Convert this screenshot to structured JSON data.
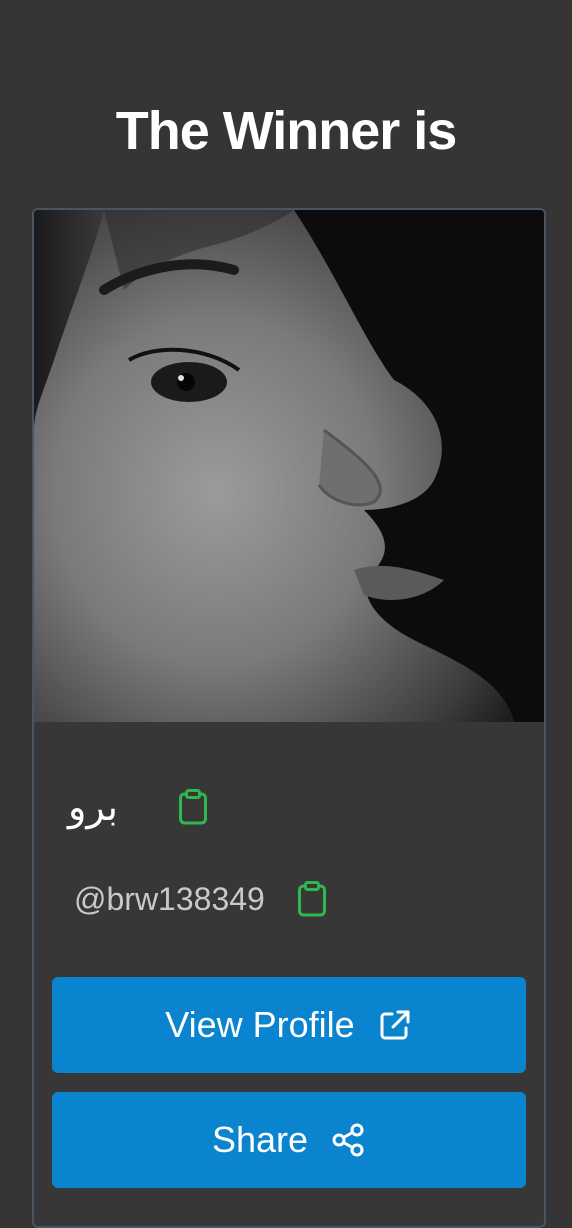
{
  "header": {
    "title": "The Winner is"
  },
  "winner": {
    "name": "برو",
    "handle": "@brw138349"
  },
  "actions": {
    "view_profile_label": "View Profile",
    "share_label": "Share"
  },
  "icons": {
    "copy": "clipboard-icon",
    "external": "external-link-icon",
    "share": "share-icon"
  },
  "colors": {
    "background": "#353535",
    "button": "#0a84ce",
    "copy_icon": "#2fb84f",
    "card_border": "#4a5563"
  }
}
